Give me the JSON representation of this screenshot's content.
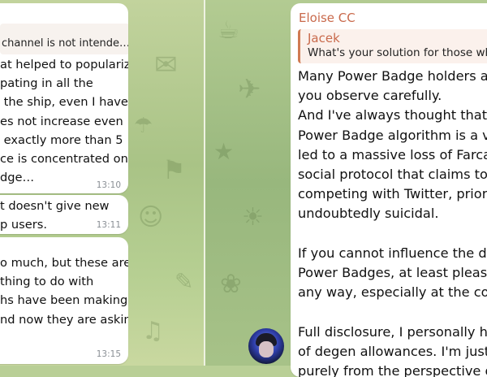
{
  "left_panel": {
    "messages": [
      {
        "quote": "channel is not intende…",
        "lines": "at helped to popularize\npating in all the\n the ship, even I have a\nes not increase even\n exactly more than 5\nce is concentrated only\ndge…",
        "time": "13:10"
      },
      {
        "lines": "t doesn't give new\np users.",
        "time": "13:11"
      },
      {
        "lines": "o much, but these are\nthing to do with\nhs have been making\nnd now they are asking",
        "time": "13:15"
      }
    ]
  },
  "right_panel": {
    "message": {
      "sender": "Eloise CC",
      "reply_author": "Jacek",
      "reply_text": "What's your solution for those whe",
      "lines": "Many Power Badge holders are\nyou observe carefully.\nAnd I've always thought that Fa\nPower Badge algorithm is a ve\nled to a massive loss of Farcas\nsocial protocol that claims to b\ncompeting with Twitter, prioritiz\nundoubtedly suicidal.\n\nIf you cannot influence the dec\nPower Badges, at least please\nany way, especially at the cost\n\nFull disclosure, I personally hav\nof degen allowances. I'm just a\npurely from the perspective of"
    },
    "avatar_icon": "user-avatar"
  },
  "colors": {
    "sender_name": "#c96a4c",
    "reply_bar": "#d07a52",
    "bubble": "#ffffff",
    "timestamp": "#8a8f95"
  }
}
